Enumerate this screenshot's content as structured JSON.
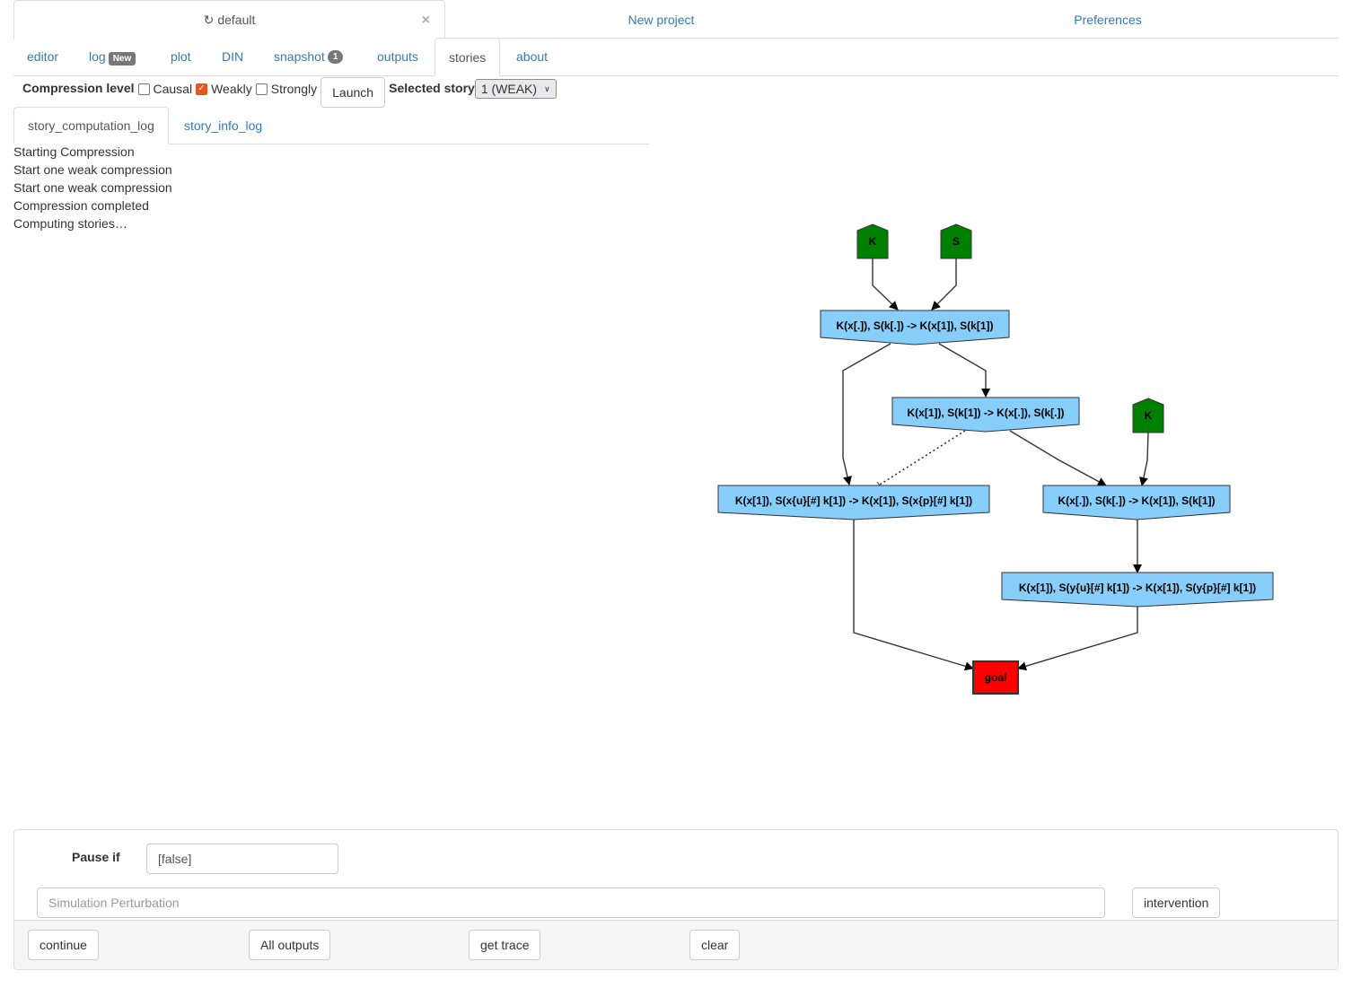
{
  "project_tabs": [
    {
      "label": "default",
      "icon": "refresh-icon",
      "active": true
    },
    {
      "label": "New project"
    },
    {
      "label": "Preferences"
    }
  ],
  "main_tabs": [
    {
      "label": "editor"
    },
    {
      "label": "log",
      "badge": "New"
    },
    {
      "label": "plot"
    },
    {
      "label": "DIN"
    },
    {
      "label": "snapshot",
      "badge": "1"
    },
    {
      "label": "outputs"
    },
    {
      "label": "stories",
      "active": true
    },
    {
      "label": "about"
    }
  ],
  "compression": {
    "label": "Compression level",
    "options": [
      {
        "label": "Causal",
        "checked": false
      },
      {
        "label": "Weakly",
        "checked": true
      },
      {
        "label": "Strongly",
        "checked": false
      }
    ],
    "launch_label": "Launch",
    "selected_story_label": "Selected story",
    "selected_story_value": "1 (WEAK)"
  },
  "sub_tabs": [
    {
      "label": "story_computation_log",
      "active": true
    },
    {
      "label": "story_info_log"
    }
  ],
  "log_lines": [
    "Starting Compression",
    "Start one weak compression",
    "Start one weak compression",
    "Compression completed",
    "Computing stories…"
  ],
  "graph": {
    "colors": {
      "init": "#008000",
      "rule": "#87cefa",
      "goal": "#ff0000",
      "edge": "#333333"
    },
    "nodes": [
      {
        "id": "k1",
        "type": "init",
        "label": "K"
      },
      {
        "id": "s1",
        "type": "init",
        "label": "S"
      },
      {
        "id": "r1",
        "type": "rule",
        "label": "K(x[.]), S(k[.]) -> K(x[1]), S(k[1])"
      },
      {
        "id": "r2",
        "type": "rule",
        "label": "K(x[1]), S(k[1]) -> K(x[.]), S(k[.])"
      },
      {
        "id": "k2",
        "type": "init",
        "label": "K"
      },
      {
        "id": "r3",
        "type": "rule",
        "label": "K(x[1]), S(x{u}[#] k[1]) -> K(x[1]), S(x{p}[#] k[1])"
      },
      {
        "id": "r4",
        "type": "rule",
        "label": "K(x[.]), S(k[.]) -> K(x[1]), S(k[1])"
      },
      {
        "id": "r5",
        "type": "rule",
        "label": "K(x[1]), S(y{u}[#] k[1]) -> K(x[1]), S(y{p}[#] k[1])"
      },
      {
        "id": "goal",
        "type": "goal",
        "label": "goal"
      }
    ],
    "edges": [
      {
        "from": "k1",
        "to": "r1"
      },
      {
        "from": "s1",
        "to": "r1"
      },
      {
        "from": "r1",
        "to": "r2"
      },
      {
        "from": "r1",
        "to": "r3"
      },
      {
        "from": "r2",
        "to": "r3",
        "style": "dotted"
      },
      {
        "from": "r2",
        "to": "r4"
      },
      {
        "from": "k2",
        "to": "r4"
      },
      {
        "from": "r4",
        "to": "r5"
      },
      {
        "from": "r3",
        "to": "goal"
      },
      {
        "from": "r5",
        "to": "goal"
      }
    ]
  },
  "bottom": {
    "pause_label": "Pause if",
    "pause_value": "[false]",
    "perturbation_placeholder": "Simulation Perturbation",
    "intervention_label": "intervention",
    "buttons": [
      "continue",
      "All outputs",
      "get trace",
      "clear"
    ]
  }
}
